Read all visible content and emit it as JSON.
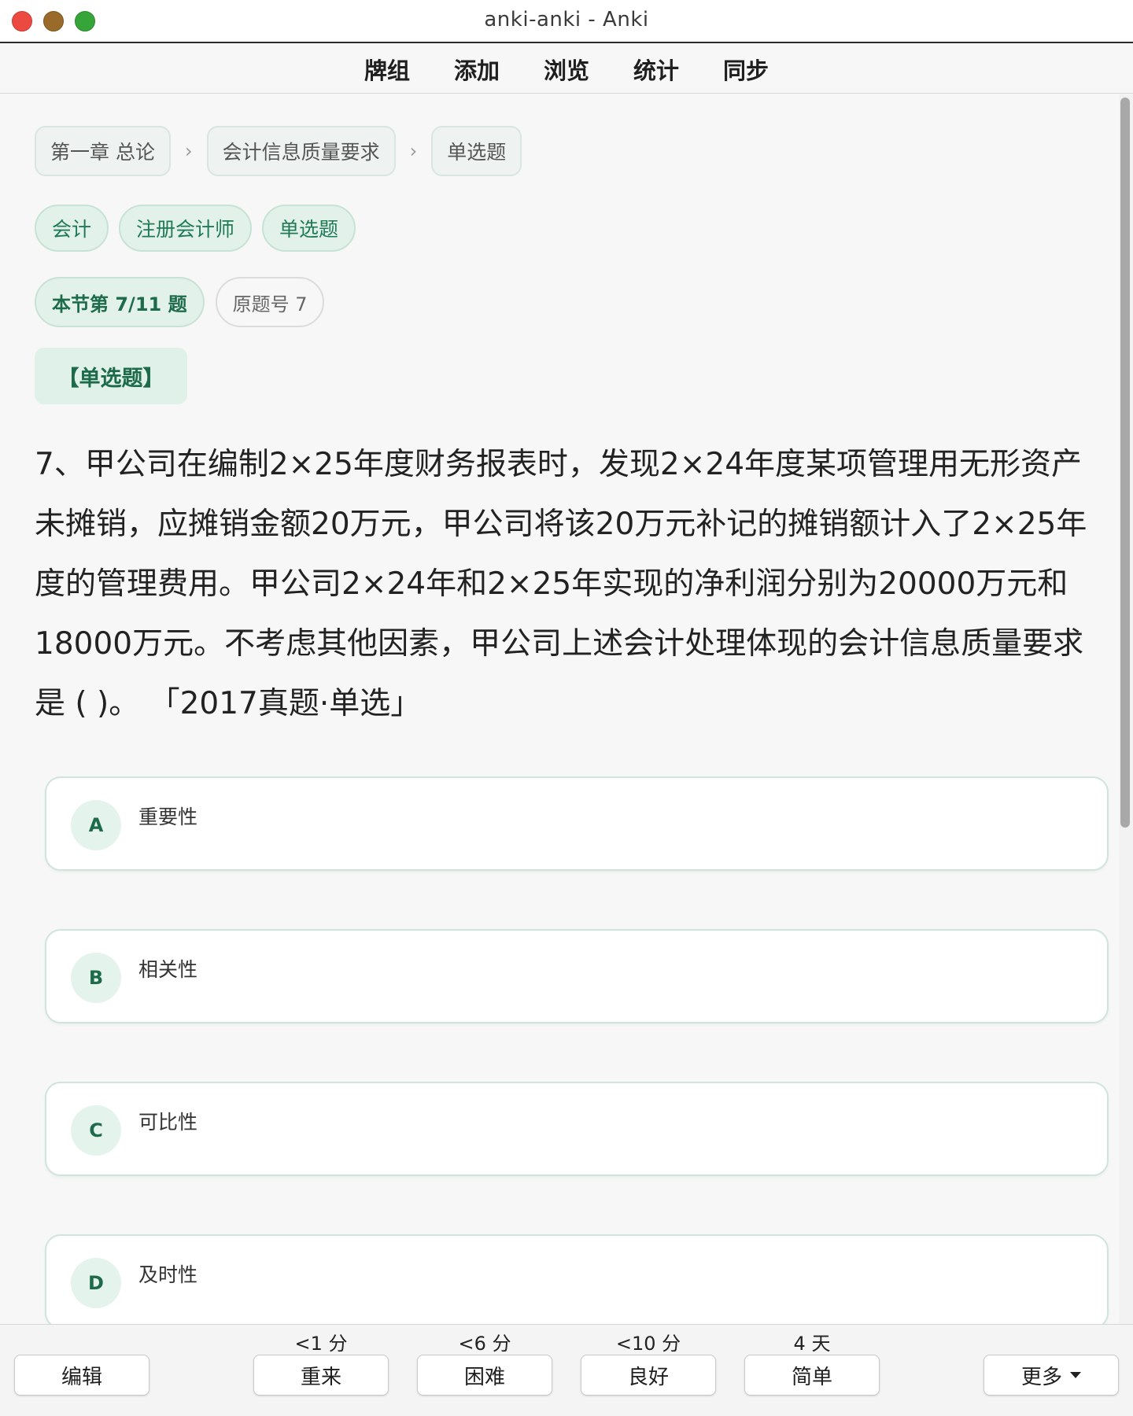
{
  "window": {
    "title": "anki-anki - Anki"
  },
  "nav": {
    "items": [
      "牌组",
      "添加",
      "浏览",
      "统计",
      "同步"
    ]
  },
  "breadcrumb": {
    "items": [
      "第一章 总论",
      "会计信息质量要求",
      "单选题"
    ],
    "separator": "›"
  },
  "tags": [
    "会计",
    "注册会计师",
    "单选题"
  ],
  "progress": {
    "label": "本节第 7/11 题",
    "original_no": "原题号 7"
  },
  "question": {
    "type": "【单选题】",
    "stem": "7、甲公司在编制2×25年度财务报表时，发现2×24年度某项管理用无形资产未摊销，应摊销金额20万元，甲公司将该20万元补记的摊销额计入了2×25年度的管理费用。甲公司2×24年和2×25年实现的净利润分别为20000万元和18000万元。不考虑其他因素，甲公司上述会计处理体现的会计信息质量要求是 ( )。 「2017真题·单选」"
  },
  "options": [
    {
      "letter": "A",
      "text": "重要性"
    },
    {
      "letter": "B",
      "text": "相关性"
    },
    {
      "letter": "C",
      "text": "可比性"
    },
    {
      "letter": "D",
      "text": "及时性"
    }
  ],
  "bottombar": {
    "edit": "编辑",
    "more": "更多",
    "answers": [
      {
        "label": "重来",
        "interval": "<1 分"
      },
      {
        "label": "困难",
        "interval": "<6 分"
      },
      {
        "label": "良好",
        "interval": "<10 分"
      },
      {
        "label": "简单",
        "interval": "4 天"
      }
    ]
  },
  "colors": {
    "accent": "#1d6b4a",
    "accent_bg": "#e2f2eb",
    "border": "#cfe5db"
  }
}
